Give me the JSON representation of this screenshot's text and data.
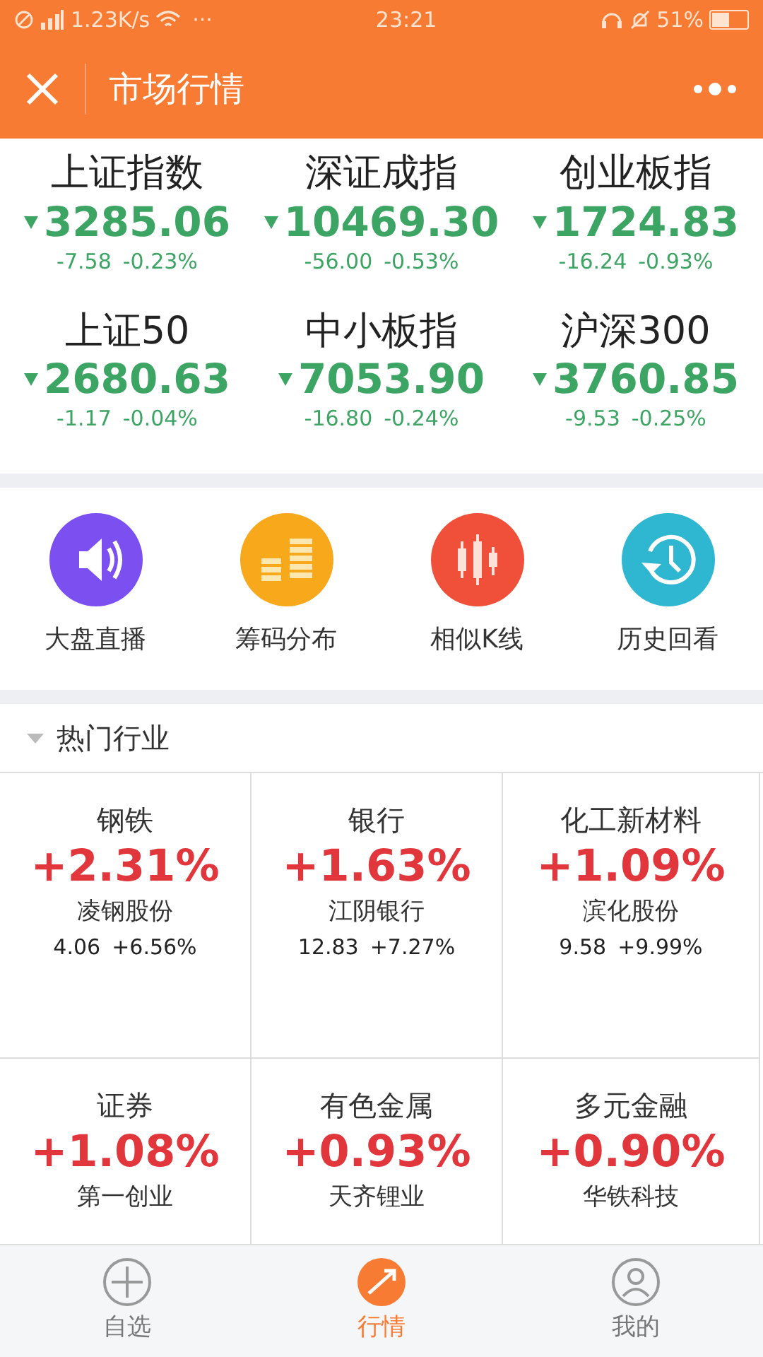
{
  "status_bar": {
    "speed": "1.23K/s",
    "dots": "···",
    "time": "23:21",
    "battery_text": "51%",
    "battery": {
      "level": 0.51
    }
  },
  "header": {
    "title": "市场行情"
  },
  "indices": [
    {
      "name": "上证指数",
      "value": "3285.06",
      "change": "-7.58",
      "percent": "-0.23%",
      "kind": "down"
    },
    {
      "name": "深证成指",
      "value": "10469.30",
      "change": "-56.00",
      "percent": "-0.53%",
      "kind": "down"
    },
    {
      "name": "创业板指",
      "value": "1724.83",
      "change": "-16.24",
      "percent": "-0.93%",
      "kind": "down"
    },
    {
      "name": "上证50",
      "value": "2680.63",
      "change": "-1.17",
      "percent": "-0.04%",
      "kind": "down"
    },
    {
      "name": "中小板指",
      "value": "7053.90",
      "change": "-16.80",
      "percent": "-0.24%",
      "kind": "down"
    },
    {
      "name": "沪深300",
      "value": "3760.85",
      "change": "-9.53",
      "percent": "-0.25%",
      "kind": "down"
    }
  ],
  "tools": [
    {
      "label": "大盘直播",
      "kind": "speaker",
      "color": "#7b4ff0"
    },
    {
      "label": "筹码分布",
      "kind": "chips",
      "color": "#f7a81b"
    },
    {
      "label": "相似K线",
      "kind": "candles",
      "color": "#f0503a"
    },
    {
      "label": "历史回看",
      "kind": "history",
      "color": "#2fb6d0"
    }
  ],
  "hot_sectors": {
    "title": "热门行业",
    "expanded": true,
    "items": [
      {
        "name": "钢铁",
        "percent": "+2.31%",
        "stock": "凌钢股份",
        "price": "4.06",
        "stock_change": "+6.56%"
      },
      {
        "name": "银行",
        "percent": "+1.63%",
        "stock": "江阴银行",
        "price": "12.83",
        "stock_change": "+7.27%"
      },
      {
        "name": "化工新材料",
        "percent": "+1.09%",
        "stock": "滨化股份",
        "price": "9.58",
        "stock_change": "+9.99%"
      },
      {
        "name": "证券",
        "percent": "+1.08%",
        "stock": "第一创业"
      },
      {
        "name": "有色金属",
        "percent": "+0.93%",
        "stock": "天齐锂业"
      },
      {
        "name": "多元金融",
        "percent": "+0.90%",
        "stock": "华铁科技"
      }
    ]
  },
  "tab_bar": [
    {
      "label": "自选",
      "kind": "plus",
      "selected": false
    },
    {
      "label": "行情",
      "kind": "trend",
      "selected": true
    },
    {
      "label": "我的",
      "kind": "person",
      "selected": false
    }
  ]
}
